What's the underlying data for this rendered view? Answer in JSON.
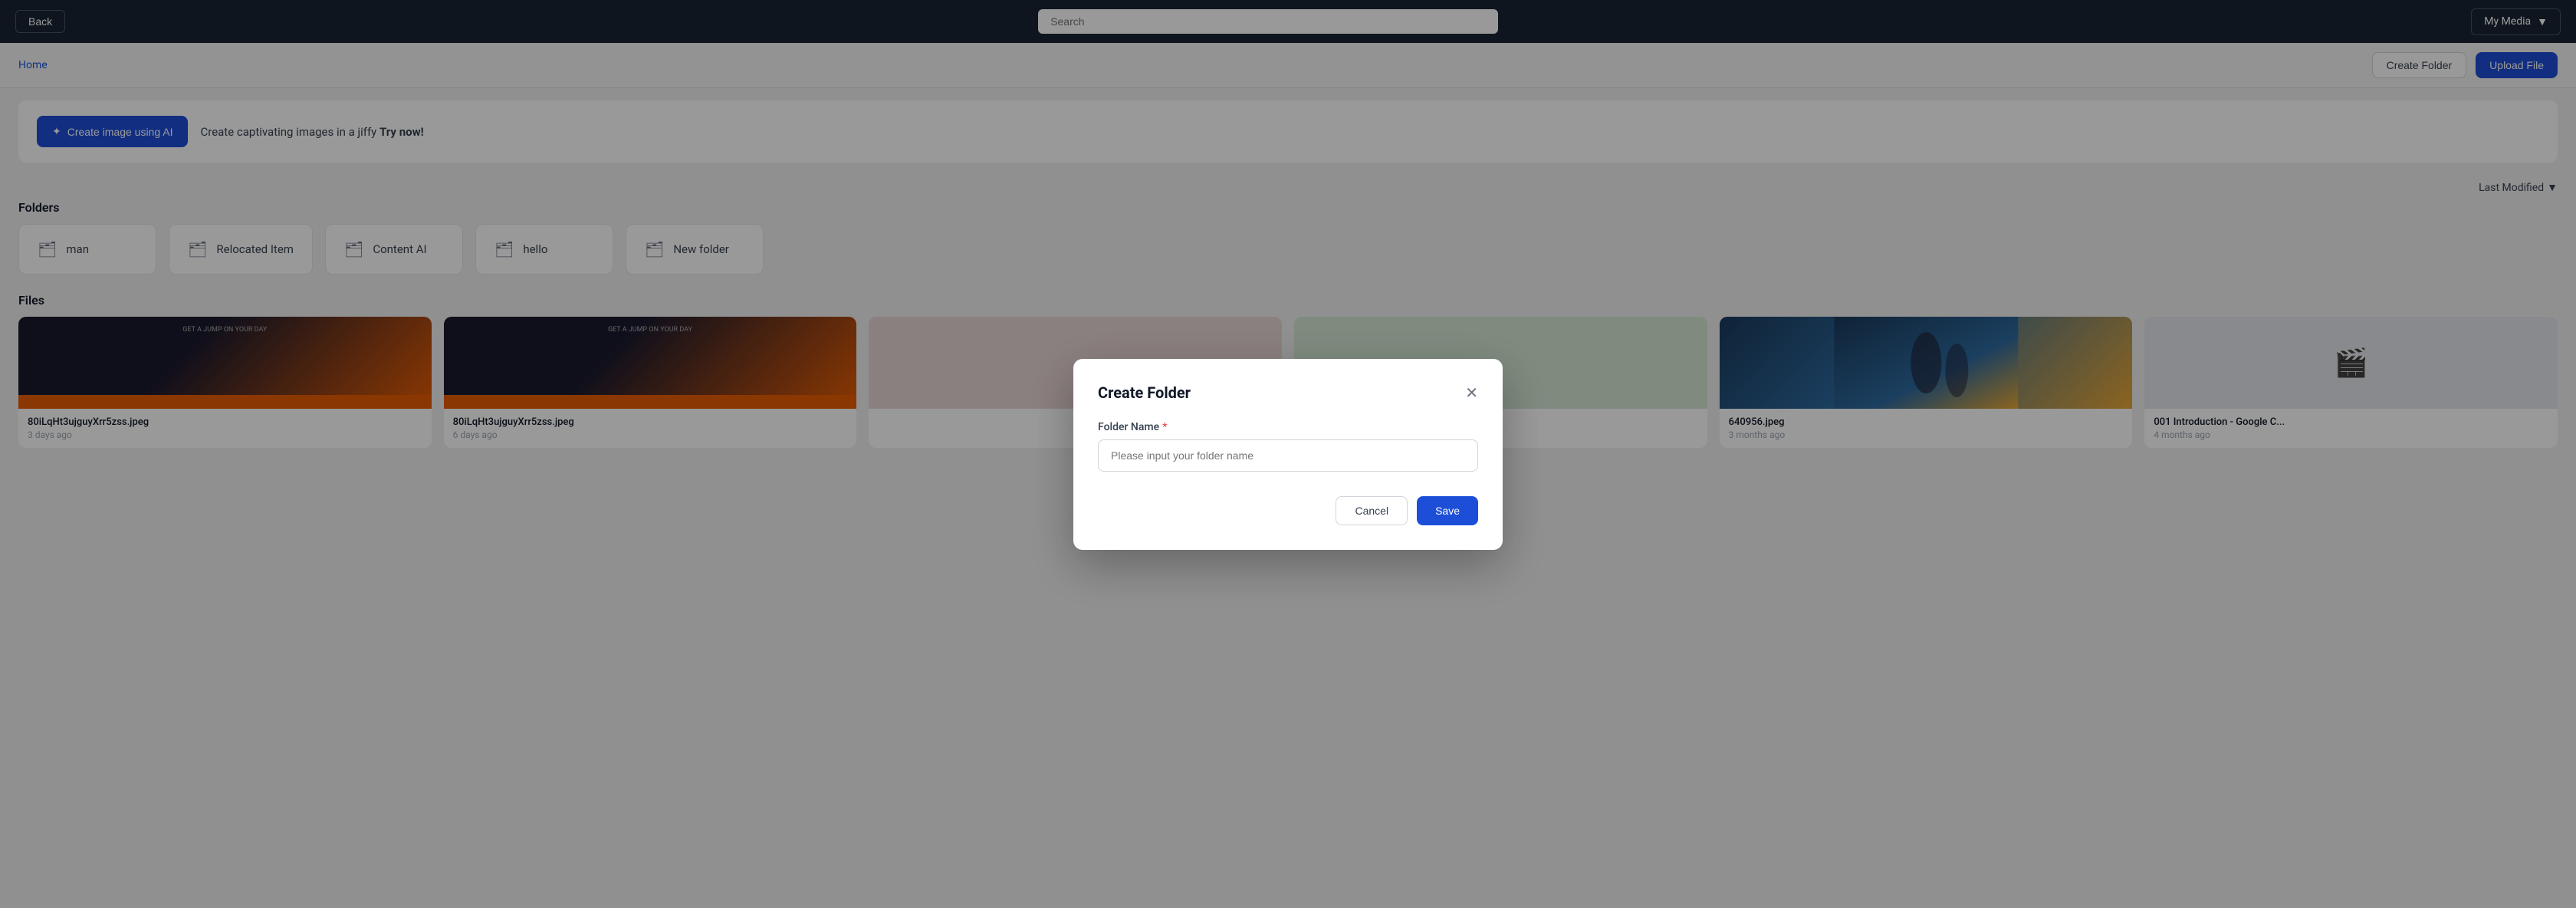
{
  "header": {
    "back_label": "Back",
    "search_placeholder": "Search",
    "media_dropdown_label": "My Media",
    "dropdown_arrow": "▼"
  },
  "topbar": {
    "home_label": "Home",
    "create_folder_label": "Create Folder",
    "upload_label": "Upload File"
  },
  "ai_banner": {
    "button_label": "Create image using AI",
    "button_icon": "✦",
    "text": "Create captivating images in a jiffy ",
    "try_now": "Try now!"
  },
  "sort": {
    "label": "Last Modified",
    "arrow": "▼"
  },
  "folders_section": {
    "title": "Folders",
    "folders": [
      {
        "name": "man"
      },
      {
        "name": "Relocated Item"
      },
      {
        "name": "Content AI"
      },
      {
        "name": "hello"
      },
      {
        "name": "New folder"
      }
    ]
  },
  "files_section": {
    "title": "Files",
    "files": [
      {
        "name": "80iLqHt3ujguyXrr5zss.jpeg",
        "date": "3 days ago",
        "type": "image-dark"
      },
      {
        "name": "80iLqHt3ujguyXrr5zss.jpeg",
        "date": "6 days ago",
        "type": "image-dark"
      },
      {
        "name": "",
        "date": "",
        "type": "placeholder"
      },
      {
        "name": "",
        "date": "",
        "type": "placeholder"
      },
      {
        "name": "640956.jpeg",
        "date": "3 months ago",
        "type": "image-anime"
      },
      {
        "name": "001 Introduction - Google C...",
        "date": "4 months ago",
        "type": "video"
      }
    ]
  },
  "modal": {
    "title": "Create Folder",
    "label": "Folder Name",
    "placeholder": "Please input your folder name",
    "cancel_label": "Cancel",
    "save_label": "Save"
  }
}
